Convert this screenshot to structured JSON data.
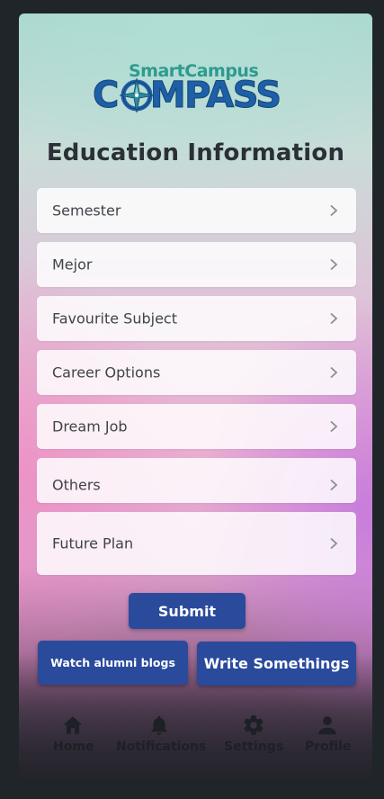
{
  "logo": {
    "line1": "SmartCampus",
    "line2_left": "C",
    "line2_right": "MPASS"
  },
  "page_title": "Education Information",
  "fields": [
    {
      "label": "Semester"
    },
    {
      "label": "Mejor"
    },
    {
      "label": "Favourite Subject"
    },
    {
      "label": "Career Options"
    },
    {
      "label": "Dream Job"
    },
    {
      "label": "Others"
    },
    {
      "label": "Future Plan"
    }
  ],
  "actions": {
    "submit_label": "Submit",
    "alumni_label": "Watch alumni blogs",
    "write_label": "Write Somethings"
  },
  "nav": {
    "home": "Home",
    "notifications": "Notifications",
    "settings": "Settings",
    "profile": "Profile"
  },
  "colors": {
    "button_bg": "#2a4a9c",
    "title_text": "#2b3036",
    "logo_primary": "#1d5fa8",
    "logo_accent": "#2f9a8e"
  },
  "icons": {
    "chevron": "chevron-right-icon",
    "home": "home-icon",
    "notifications": "bell-icon",
    "settings": "gear-icon",
    "profile": "person-icon",
    "logo_compass": "compass-icon"
  }
}
